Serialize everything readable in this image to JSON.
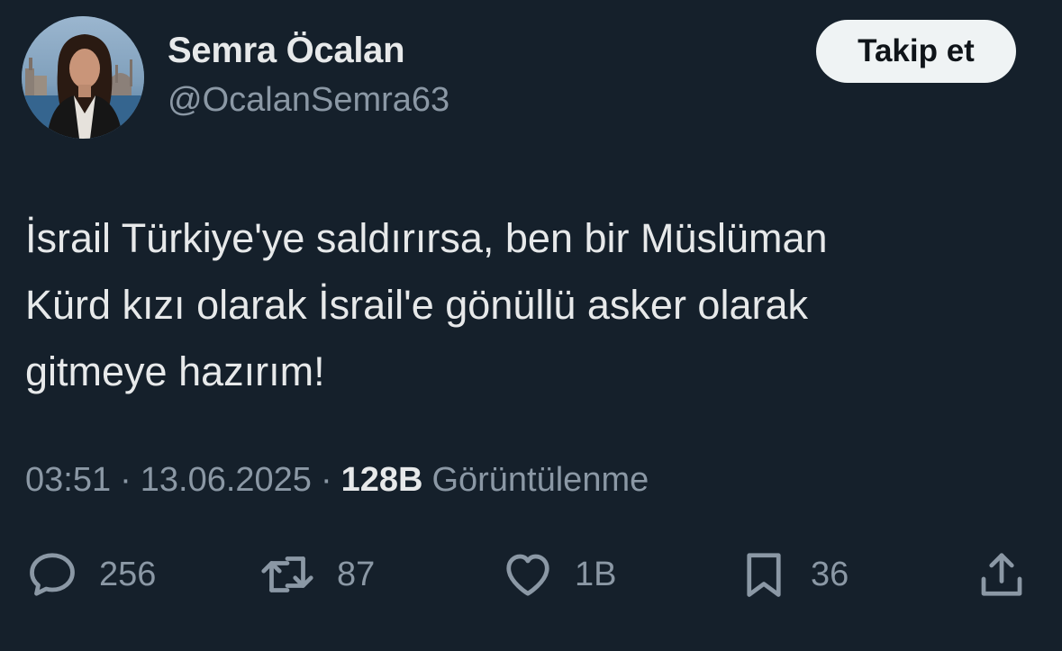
{
  "user": {
    "display_name": "Semra Öcalan",
    "handle": "@OcalanSemra63",
    "avatar_icon": "profile-photo"
  },
  "follow_button": {
    "label": "Takip et"
  },
  "tweet": {
    "lines": [
      "İsrail Türkiye'ye saldırırsa, ben bir Müslüman",
      "Kürd kızı olarak İsrail'e gönüllü asker olarak",
      "gitmeye hazırım!"
    ]
  },
  "meta": {
    "time": "03:51",
    "separator": "·",
    "date": "13.06.2025",
    "views_count": "128B",
    "views_label": "Görüntülenme"
  },
  "actions": {
    "replies": {
      "icon": "reply-icon",
      "count": "256"
    },
    "retweets": {
      "icon": "retweet-icon",
      "count": "87"
    },
    "likes": {
      "icon": "heart-icon",
      "count": "1B"
    },
    "bookmarks": {
      "icon": "bookmark-icon",
      "count": "36"
    },
    "share": {
      "icon": "share-icon"
    }
  },
  "colors": {
    "background": "#15202b",
    "primary_text": "#e7e9ea",
    "secondary_text": "#8b98a5",
    "button_bg": "#eff3f4",
    "button_text": "#0f1419"
  }
}
